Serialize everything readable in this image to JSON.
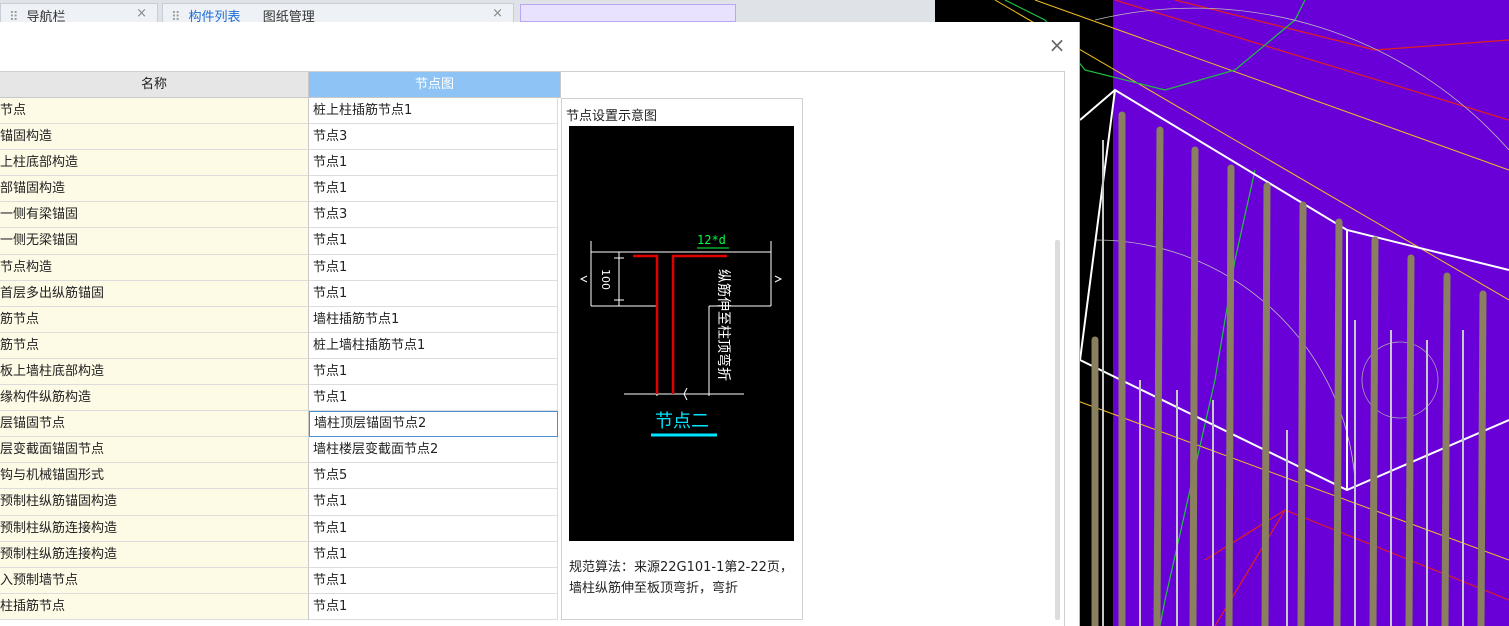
{
  "tabs": [
    {
      "label": "导航栏",
      "active": false
    },
    {
      "label": "构件列表",
      "active": true
    },
    {
      "label": "图纸管理",
      "active": false
    }
  ],
  "dialog": {
    "close_label": "×",
    "columns": {
      "name": "名称",
      "node": "节点图"
    },
    "rows": [
      {
        "name": "节点",
        "node": "桩上柱插筋节点1"
      },
      {
        "name": "锚固构造",
        "node": "节点3"
      },
      {
        "name": "上柱底部构造",
        "node": "节点1"
      },
      {
        "name": "部锚固构造",
        "node": "节点1"
      },
      {
        "name": "一侧有梁锚固",
        "node": "节点3"
      },
      {
        "name": "一侧无梁锚固",
        "node": "节点1"
      },
      {
        "name": "节点构造",
        "node": "节点1"
      },
      {
        "name": "首层多出纵筋锚固",
        "node": "节点1"
      },
      {
        "name": "筋节点",
        "node": "墙柱插筋节点1"
      },
      {
        "name": "筋节点",
        "node": "桩上墙柱插筋节点1"
      },
      {
        "name": "板上墙柱底部构造",
        "node": "节点1"
      },
      {
        "name": "缘构件纵筋构造",
        "node": "节点1"
      },
      {
        "name": "层锚固节点",
        "node": "墙柱顶层锚固节点2",
        "selected": true
      },
      {
        "name": "层变截面锚固节点",
        "node": "墙柱楼层变截面节点2"
      },
      {
        "name": "钩与机械锚固形式",
        "node": "节点5"
      },
      {
        "name": "预制柱纵筋锚固构造",
        "node": "节点1"
      },
      {
        "name": "预制柱纵筋连接构造",
        "node": "节点1"
      },
      {
        "name": "预制柱纵筋连接构造",
        "node": "节点1"
      },
      {
        "name": "入预制墙节点",
        "node": "节点1"
      },
      {
        "name": "柱插筋节点",
        "node": "节点1"
      }
    ],
    "preview": {
      "title": "节点设置示意图",
      "diagram": {
        "dim_top": "12*d",
        "dim_left": "100",
        "vertical_note": "纵筋伸至柱顶弯折",
        "caption": "节点二"
      },
      "description": "规范算法：来源22G101-1第2-22页，墙柱纵筋伸至板顶弯折，弯折"
    }
  },
  "colors": {
    "viewport_bg": "#6a00d8",
    "header_selected": "#8ec4f5",
    "name_cell_bg": "#fdfae6",
    "rebar_red": "#e00000",
    "caption_cyan": "#00e5ff",
    "dim_green": "#00ff40"
  }
}
